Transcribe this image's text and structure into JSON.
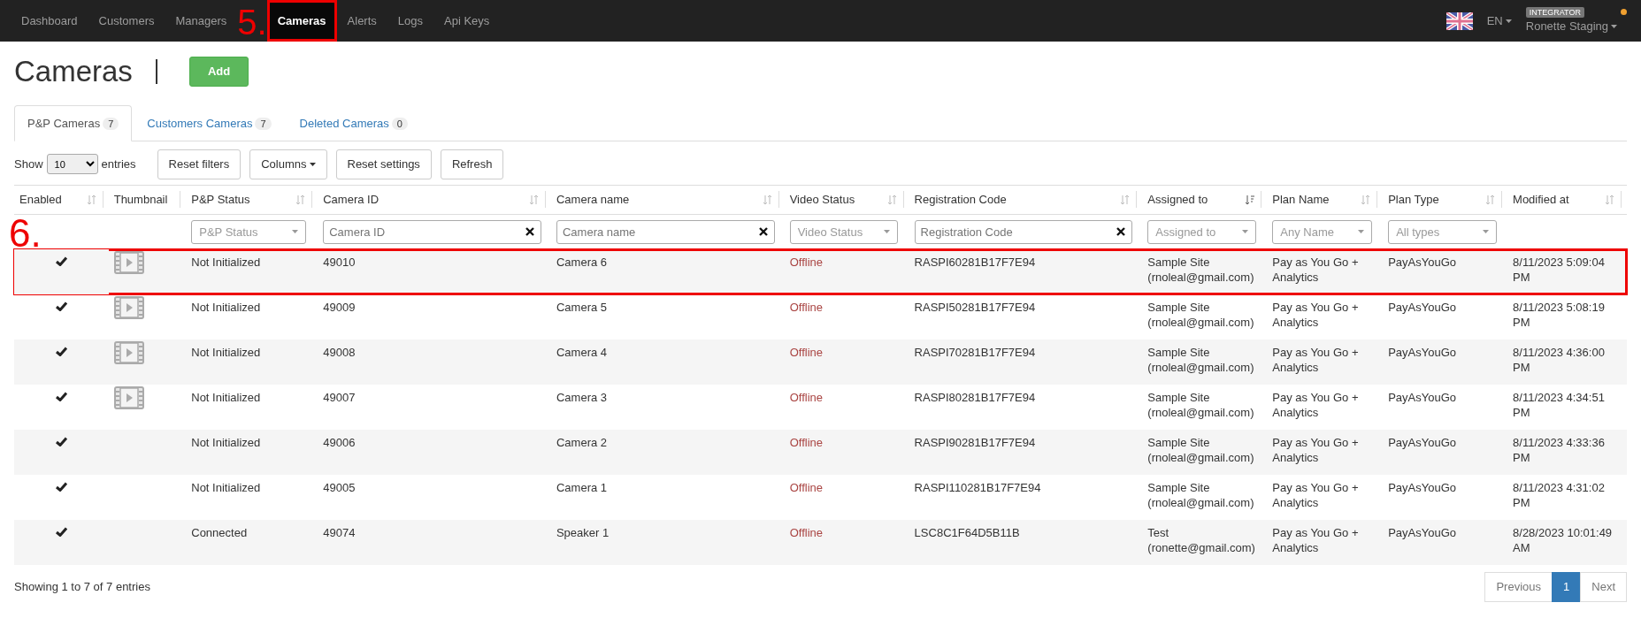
{
  "navbar": {
    "items": [
      {
        "label": "Dashboard",
        "selected": false
      },
      {
        "label": "Customers",
        "selected": false
      },
      {
        "label": "Managers",
        "selected": false
      },
      {
        "label": "Cameras",
        "selected": true,
        "annotation": "5."
      },
      {
        "label": "Alerts",
        "selected": false
      },
      {
        "label": "Logs",
        "selected": false
      },
      {
        "label": "Api Keys",
        "selected": false
      }
    ],
    "language": "EN",
    "role_badge": "INTEGRATOR",
    "user": "Ronette Staging"
  },
  "page": {
    "title": "Cameras",
    "add_button": "Add"
  },
  "tabs": [
    {
      "label": "P&P Cameras",
      "count": "7",
      "selected": true
    },
    {
      "label": "Customers Cameras",
      "count": "7",
      "selected": false
    },
    {
      "label": "Deleted Cameras",
      "count": "0",
      "selected": false
    }
  ],
  "toolbar": {
    "show_label": "Show",
    "page_size": "10",
    "entries_label": "entries",
    "buttons": [
      {
        "label": "Reset filters",
        "kind": "plain"
      },
      {
        "label": "Columns",
        "kind": "dropdown"
      },
      {
        "label": "Reset settings",
        "kind": "plain"
      },
      {
        "label": "Refresh",
        "kind": "plain"
      }
    ]
  },
  "table": {
    "columns": [
      {
        "label": "Enabled",
        "sortable": true,
        "sorted": false
      },
      {
        "label": "Thumbnail",
        "sortable": false
      },
      {
        "label": "P&P Status",
        "sortable": true,
        "sorted": false,
        "filter": {
          "kind": "select",
          "placeholder": "P&P Status"
        }
      },
      {
        "label": "Camera ID",
        "sortable": true,
        "sorted": false,
        "filter": {
          "kind": "text",
          "placeholder": "Camera ID"
        }
      },
      {
        "label": "Camera name",
        "sortable": true,
        "sorted": false,
        "filter": {
          "kind": "text",
          "placeholder": "Camera name"
        }
      },
      {
        "label": "Video Status",
        "sortable": true,
        "sorted": false,
        "filter": {
          "kind": "select",
          "placeholder": "Video Status"
        }
      },
      {
        "label": "Registration Code",
        "sortable": true,
        "sorted": false,
        "filter": {
          "kind": "text",
          "placeholder": "Registration Code"
        }
      },
      {
        "label": "Assigned to",
        "sortable": true,
        "sorted": true,
        "filter": {
          "kind": "select",
          "placeholder": "Assigned to"
        }
      },
      {
        "label": "Plan Name",
        "sortable": true,
        "sorted": false,
        "filter": {
          "kind": "select",
          "placeholder": "Any Name"
        }
      },
      {
        "label": "Plan Type",
        "sortable": true,
        "sorted": false,
        "filter": {
          "kind": "select",
          "placeholder": "All types"
        }
      },
      {
        "label": "Modified at",
        "sortable": true,
        "sorted": false
      }
    ],
    "rows": [
      {
        "enabled": true,
        "has_thumbnail": true,
        "status": "Not Initialized",
        "camera_id": "49010",
        "name": "Camera 6",
        "video_status": "Offline",
        "registration_code": "RASPI60281B17F7E94",
        "site": "Sample Site",
        "email": "(rnoleal@gmail.com)",
        "plan_name": "Pay as You Go + Analytics",
        "plan_type": "PayAsYouGo",
        "modified": "8/11/2023 5:09:04 PM",
        "annotation": "6."
      },
      {
        "enabled": true,
        "has_thumbnail": true,
        "status": "Not Initialized",
        "camera_id": "49009",
        "name": "Camera 5",
        "video_status": "Offline",
        "registration_code": "RASPI50281B17F7E94",
        "site": "Sample Site",
        "email": "(rnoleal@gmail.com)",
        "plan_name": "Pay as You Go + Analytics",
        "plan_type": "PayAsYouGo",
        "modified": "8/11/2023 5:08:19 PM"
      },
      {
        "enabled": true,
        "has_thumbnail": true,
        "status": "Not Initialized",
        "camera_id": "49008",
        "name": "Camera 4",
        "video_status": "Offline",
        "registration_code": "RASPI70281B17F7E94",
        "site": "Sample Site",
        "email": "(rnoleal@gmail.com)",
        "plan_name": "Pay as You Go + Analytics",
        "plan_type": "PayAsYouGo",
        "modified": "8/11/2023 4:36:00 PM"
      },
      {
        "enabled": true,
        "has_thumbnail": true,
        "status": "Not Initialized",
        "camera_id": "49007",
        "name": "Camera 3",
        "video_status": "Offline",
        "registration_code": "RASPI80281B17F7E94",
        "site": "Sample Site",
        "email": "(rnoleal@gmail.com)",
        "plan_name": "Pay as You Go + Analytics",
        "plan_type": "PayAsYouGo",
        "modified": "8/11/2023 4:34:51 PM"
      },
      {
        "enabled": true,
        "has_thumbnail": false,
        "status": "Not Initialized",
        "camera_id": "49006",
        "name": "Camera 2",
        "video_status": "Offline",
        "registration_code": "RASPI90281B17F7E94",
        "site": "Sample Site",
        "email": "(rnoleal@gmail.com)",
        "plan_name": "Pay as You Go + Analytics",
        "plan_type": "PayAsYouGo",
        "modified": "8/11/2023 4:33:36 PM"
      },
      {
        "enabled": true,
        "has_thumbnail": false,
        "status": "Not Initialized",
        "camera_id": "49005",
        "name": "Camera 1",
        "video_status": "Offline",
        "registration_code": "RASPI110281B17F7E94",
        "site": "Sample Site",
        "email": "(rnoleal@gmail.com)",
        "plan_name": "Pay as You Go + Analytics",
        "plan_type": "PayAsYouGo",
        "modified": "8/11/2023 4:31:02 PM"
      },
      {
        "enabled": true,
        "has_thumbnail": false,
        "status": "Connected",
        "camera_id": "49074",
        "name": "Speaker 1",
        "video_status": "Offline",
        "registration_code": "LSC8C1F64D5B11B",
        "site": "Test",
        "email": "(ronette@gmail.com)",
        "plan_name": "Pay as You Go + Analytics",
        "plan_type": "PayAsYouGo",
        "modified": "8/28/2023 10:01:49 AM"
      }
    ]
  },
  "footer": {
    "info": "Showing 1 to 7 of 7 entries",
    "pagination": [
      {
        "label": "Previous",
        "selected": false
      },
      {
        "label": "1",
        "selected": true
      },
      {
        "label": "Next",
        "selected": false
      }
    ]
  }
}
